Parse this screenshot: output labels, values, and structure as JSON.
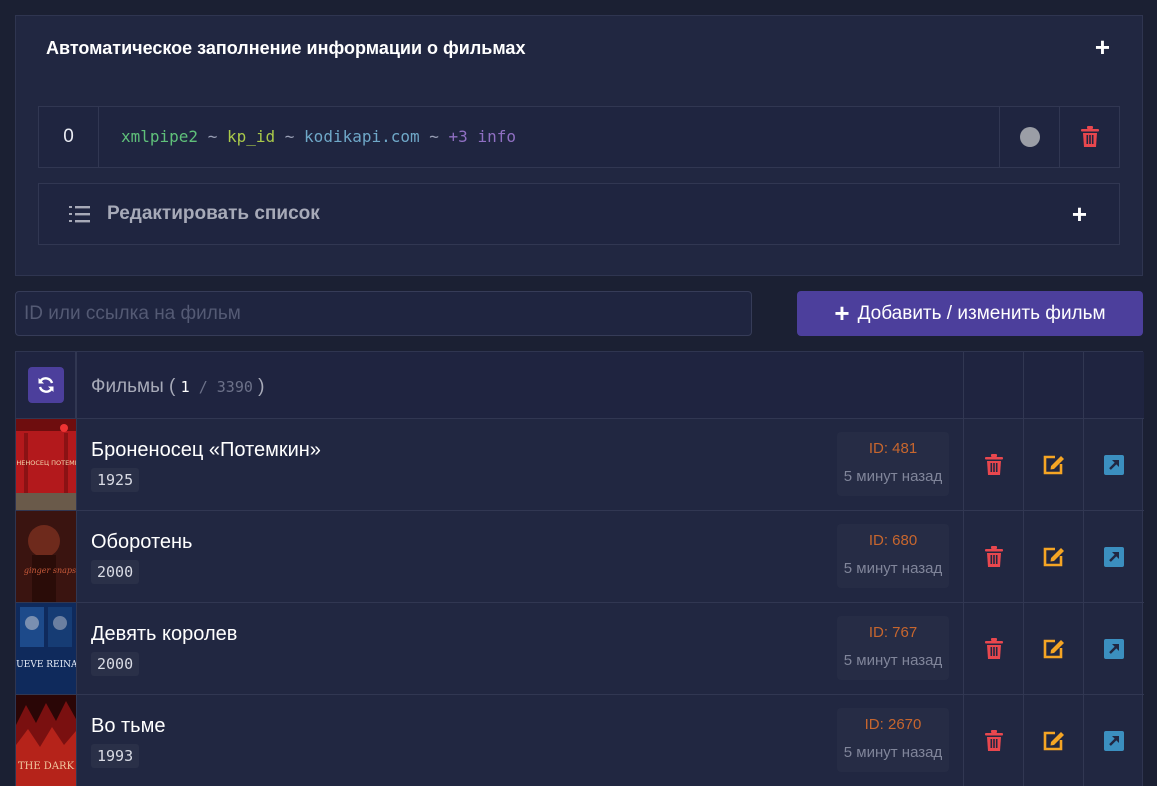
{
  "colors": {
    "background": "#1b2033",
    "panel": "#212741",
    "accent": "#4c3f9c",
    "delete": "#e8474e",
    "edit": "#f5a524",
    "open": "#3b8fbf",
    "id_text": "#c7662e"
  },
  "autofill": {
    "title": "Автоматическое заполнение информации о фильмах",
    "add_icon": "plus-icon",
    "sources": [
      {
        "index": "0",
        "parts": {
          "source": "xmlpipe2",
          "sep1": " ~ ",
          "key": "kp_id",
          "sep2": " ~ ",
          "domain": "kodikapi.com",
          "sep3": " ~ ",
          "extra": "+3 info"
        },
        "status_icon": "status-dot-icon",
        "delete_icon": "trash-icon"
      }
    ],
    "edit_list": {
      "icon": "list-ordered-icon",
      "label": "Редактировать список",
      "add_icon": "plus-icon"
    }
  },
  "search": {
    "placeholder": "ID или ссылка на фильм",
    "value": ""
  },
  "add_button": {
    "icon": "plus-icon",
    "label": "Добавить / изменить фильм"
  },
  "films": {
    "header": {
      "refresh_icon": "refresh-icon",
      "label": "Фильмы",
      "open_paren": " ( ",
      "current": "1",
      "separator": " / ",
      "total": "3390",
      "close_paren": " )"
    },
    "rows": [
      {
        "title": "Броненосец «Потемкин»",
        "year": "1925",
        "id": "ID: 481",
        "time": "5 минут назад",
        "poster_text": "БРОНЕНОСЕЦ ПОТЕМКИН"
      },
      {
        "title": "Оборотень",
        "year": "2000",
        "id": "ID: 680",
        "time": "5 минут назад",
        "poster_text": "ginger snaps"
      },
      {
        "title": "Девять королев",
        "year": "2000",
        "id": "ID: 767",
        "time": "5 минут назад",
        "poster_text": "NUEVE REINAS"
      },
      {
        "title": "Во тьме",
        "year": "1993",
        "id": "ID: 2670",
        "time": "5 минут назад",
        "poster_text": "THE DARK"
      }
    ],
    "row_icons": {
      "delete": "trash-icon",
      "edit": "edit-icon",
      "open": "external-link-icon"
    }
  }
}
